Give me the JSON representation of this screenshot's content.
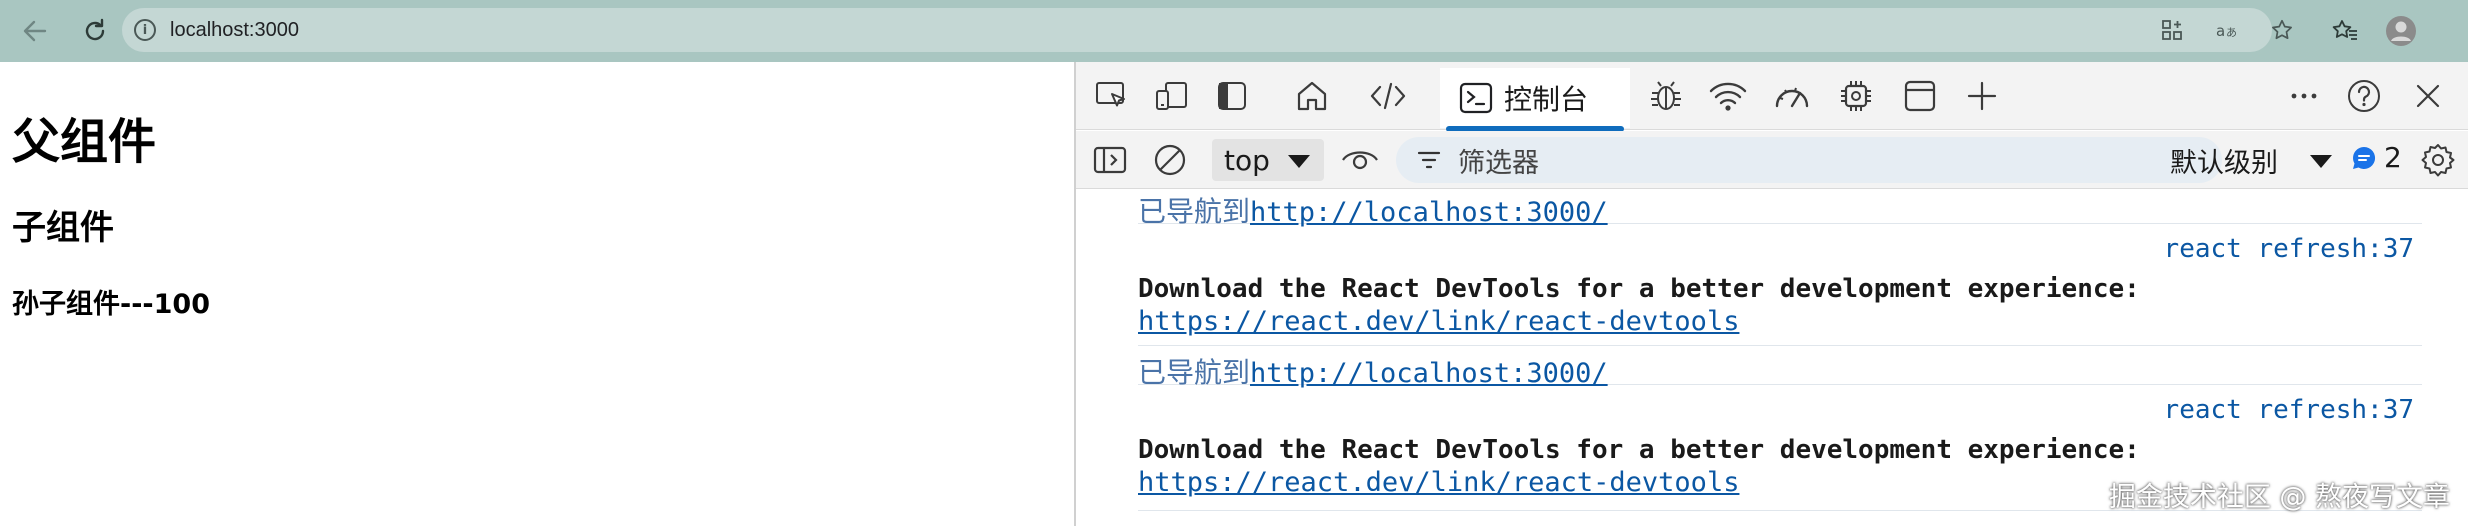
{
  "browser": {
    "url": "localhost:3000",
    "info_glyph": "i"
  },
  "page": {
    "h1": "父组件",
    "h2": "子组件",
    "h3": "孙子组件---100"
  },
  "devtools": {
    "tabs": {
      "console_label": "控制台"
    },
    "toolbar": {
      "context_value": "top",
      "filter_placeholder": "筛选器",
      "level_value": "默认级别",
      "issues_count": "2"
    },
    "messages": [
      {
        "type": "navigation",
        "prefix": "已导航到",
        "link": "http://localhost:3000/"
      },
      {
        "type": "info",
        "source": "react refresh:37",
        "text": "Download the React DevTools for a better development experience:",
        "link": "https://react.dev/link/react-devtools"
      },
      {
        "type": "navigation",
        "prefix": "已导航到",
        "link": "http://localhost:3000/"
      },
      {
        "type": "info",
        "source": "react refresh:37",
        "text": "Download the React DevTools for a better development experience:",
        "link": "https://react.dev/link/react-devtools"
      }
    ]
  },
  "watermark": "掘金技术社区 @ 熬夜写文章",
  "colors": {
    "chrome_bar": "#a9c6c1",
    "accent": "#0f6cbd",
    "link": "#0b57a3"
  }
}
